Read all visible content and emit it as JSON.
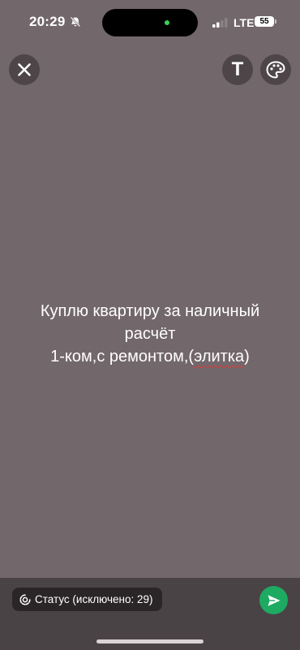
{
  "status_bar": {
    "time": "20:29",
    "network": "LTE",
    "battery": "55",
    "icons": [
      "bell-muted-icon",
      "signal-icon",
      "battery-icon"
    ]
  },
  "toolbar": {
    "close_icon": "close-icon",
    "text_tool_label": "T",
    "palette_icon": "palette-icon"
  },
  "story": {
    "line1": "Куплю квартиру за наличный",
    "line2": "расчёт",
    "line3_prefix": "1-ком,с ремонтом,(",
    "line3_underlined": "элитка",
    "line3_suffix": ")",
    "background_color": "#72676a"
  },
  "footer": {
    "status_label": "Статус (исключено: 29)",
    "status_icon": "status-ring-icon",
    "send_icon": "send-icon",
    "send_color": "#1daa61"
  }
}
